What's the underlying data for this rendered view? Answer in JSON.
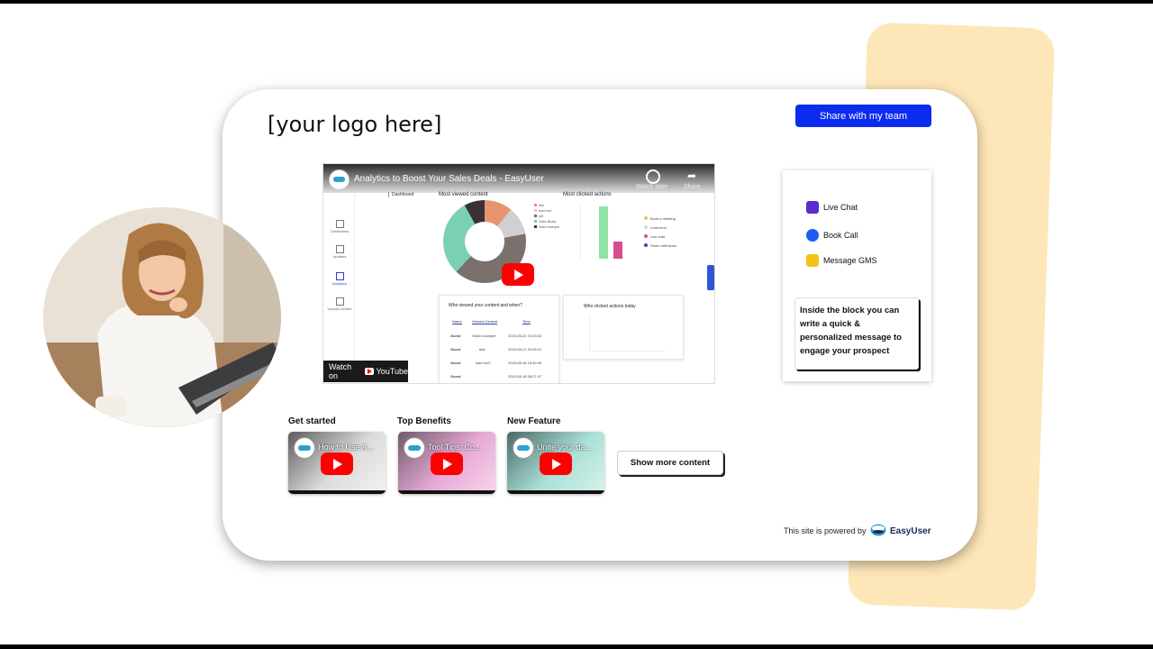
{
  "page": {
    "logo_text": "[your logo here]",
    "share_button": "Share with my team"
  },
  "video": {
    "title": "Analytics to Boost Your Sales Deals - EasyUser",
    "watch_later": "Watch later",
    "share": "Share",
    "watch_on": "Watch on",
    "youtube": "YouTube",
    "dashboard": {
      "breadcrumb": "Dashboard",
      "nav": [
        "CreateView",
        "Updates",
        "Analytics",
        "Upload content"
      ],
      "most_viewed": "Most viewed content",
      "most_clicked": "Most clicked actions",
      "donut_legend": [
        "test",
        "lead rnd?",
        "pdf",
        "Video library",
        "Video example"
      ],
      "clicked_legend": [
        "Book a meeting",
        "Lead form",
        "Live chat",
        "Share with team"
      ],
      "who_viewed": "Who viewed your content and when?",
      "who_clicked": "Who clicked actions today",
      "table_headers": [
        "Name",
        "Viewed Content",
        "Time"
      ],
      "table_rows": [
        {
          "name": "Guest",
          "content": "Video example",
          "time": "2023-08-22 13:23:02"
        },
        {
          "name": "Guest",
          "content": "test",
          "time": "2023-08-21 20:05:12"
        },
        {
          "name": "Guest",
          "content": "lead rnd?",
          "time": "2023-08-18 15:40:40"
        },
        {
          "name": "Guest",
          "content": "",
          "time": "2023-08-18 08:27:47"
        }
      ]
    }
  },
  "chat": {
    "items": [
      {
        "label": "Live Chat",
        "color": "#5b2bd0"
      },
      {
        "label": "Book Call",
        "color": "#1a5cf0"
      },
      {
        "label": "Message GMS",
        "color": "#f2c21a"
      }
    ],
    "message": "Inside the block you can write a quick & personalized message to engage your prospect"
  },
  "thumbnails": [
    {
      "label": "Get started",
      "title": "How to Use A..."
    },
    {
      "label": "Top Benefits",
      "title": "Tool Tips: Co..."
    },
    {
      "label": "New Feature",
      "title": "Unite your da..."
    }
  ],
  "show_more": "Show more content",
  "footer": {
    "powered_by": "This site is powered by",
    "brand": "EasyUser"
  },
  "colors": {
    "accent": "#0b2cf0",
    "peach": "#fde6b8",
    "youtube_red": "#ff0000"
  }
}
